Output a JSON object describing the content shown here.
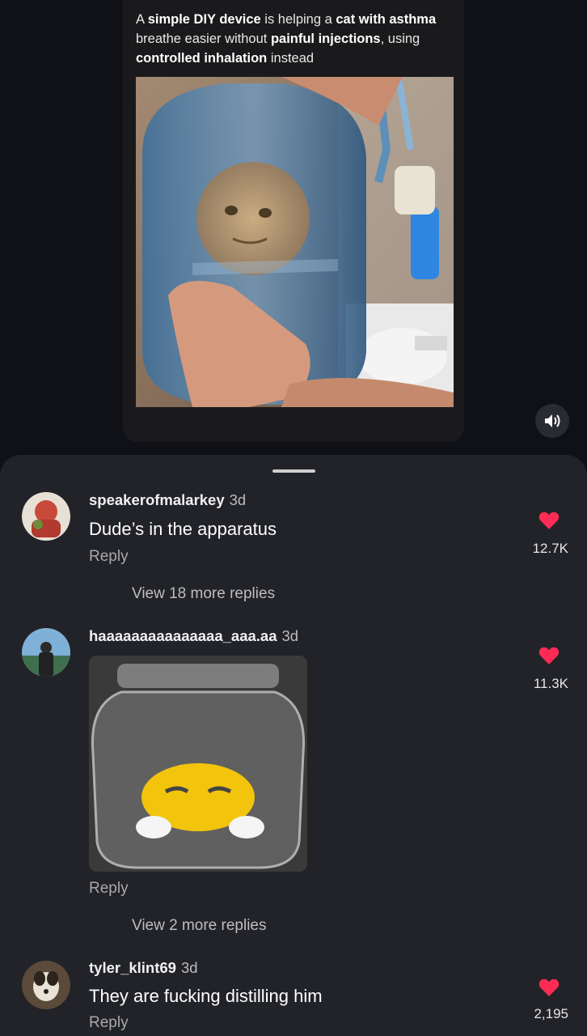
{
  "video": {
    "caption_parts": [
      {
        "text": "A ",
        "bold": false
      },
      {
        "text": "simple DIY device",
        "bold": true
      },
      {
        "text": " is helping a ",
        "bold": false
      },
      {
        "text": "cat with asthma",
        "bold": true
      },
      {
        "text": " breathe easier without ",
        "bold": false
      },
      {
        "text": "painful injections",
        "bold": true
      },
      {
        "text": ", using ",
        "bold": false
      },
      {
        "text": "controlled inhalation",
        "bold": true
      },
      {
        "text": " instead",
        "bold": false
      }
    ],
    "mute_icon": "speaker-icon"
  },
  "comments": [
    {
      "username": "speakerofmalarkey",
      "time": "3d",
      "text": "Dude’s in the apparatus",
      "reply": "Reply",
      "likes": "12.7K",
      "view_more": "View 18 more replies"
    },
    {
      "username": "haaaaaaaaaaaaaaa_aaa.aa",
      "time": "3d",
      "text": "",
      "reply": "Reply",
      "likes": "11.3K",
      "view_more": "View 2 more replies"
    },
    {
      "username": "tyler_klint69",
      "time": "3d",
      "text": "They are fucking distilling him",
      "reply": "Reply",
      "likes": "2,195"
    }
  ],
  "colors": {
    "like": "#fe2c55",
    "sheet": "#222328",
    "background": "#0d0e12"
  }
}
